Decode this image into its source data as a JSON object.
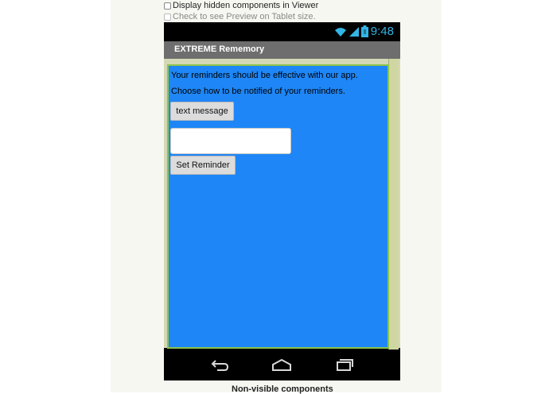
{
  "options": {
    "display_hidden": "Display hidden components in Viewer",
    "tablet_preview": "Check to see Preview on Tablet size."
  },
  "status_bar": {
    "time": "9:48",
    "icons": [
      "wifi-icon",
      "signal-icon",
      "battery-icon"
    ],
    "accent_color": "#33b5e5"
  },
  "app": {
    "title": "EXTREME Rememory",
    "screen_color": "#1e86f6",
    "label1": "Your reminders should be effective with our app.",
    "label2": "Choose how to be notified of your reminders.",
    "notify_button": "text message",
    "reminder_input": "",
    "set_button": "Set Reminder"
  },
  "nav_bar": {
    "icons": [
      "back-icon",
      "home-icon",
      "recents-icon"
    ]
  },
  "footer": {
    "non_visible_label": "Non-visible components"
  }
}
